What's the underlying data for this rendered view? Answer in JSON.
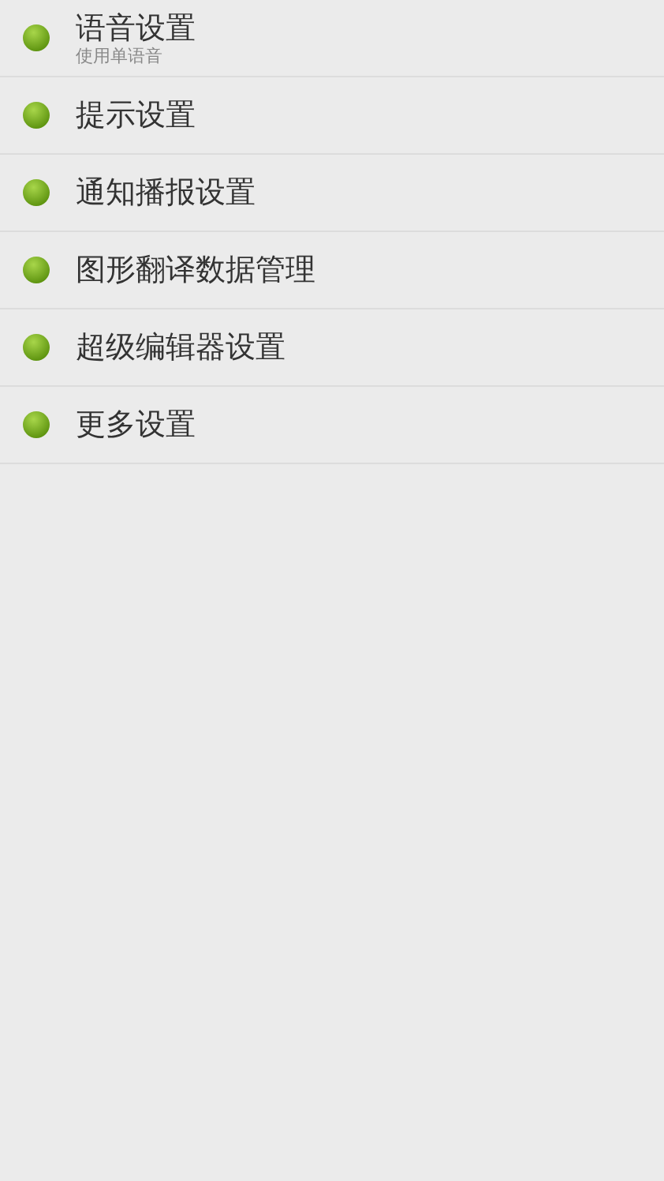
{
  "items": [
    {
      "title": "语音设置",
      "subtitle": "使用单语音"
    },
    {
      "title": "提示设置"
    },
    {
      "title": "通知播报设置"
    },
    {
      "title": "图形翻译数据管理"
    },
    {
      "title": "超级编辑器设置"
    },
    {
      "title": "更多设置"
    }
  ]
}
